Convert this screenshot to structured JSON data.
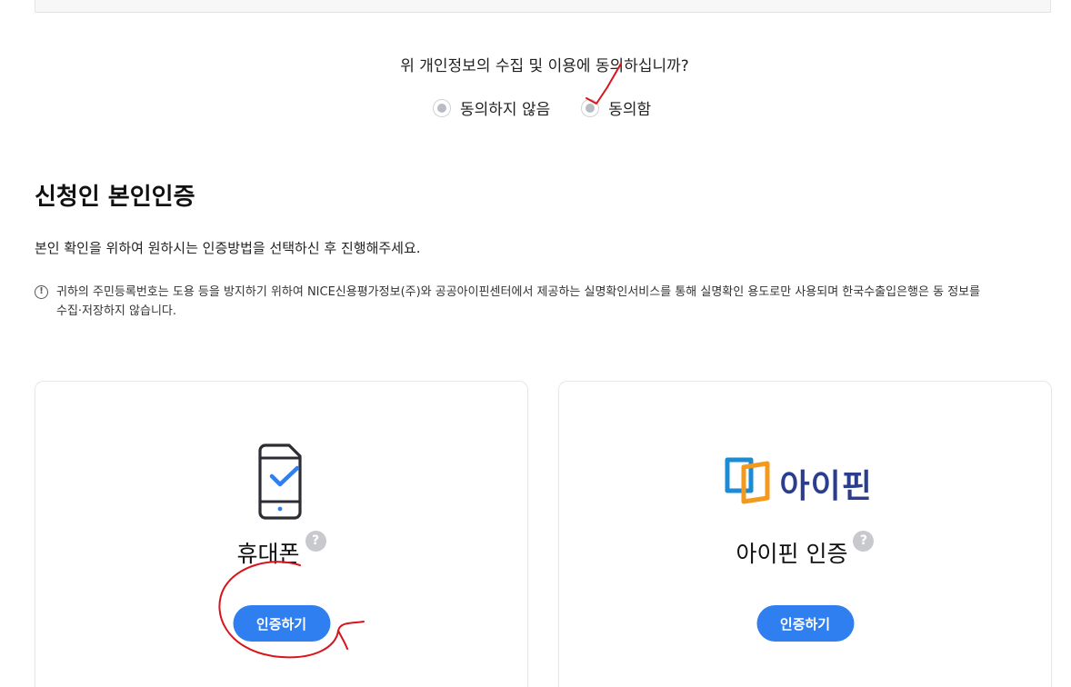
{
  "consent": {
    "question": "위 개인정보의 수집 및 이용에 동의하십니까?",
    "options": [
      {
        "label": "동의하지 않음"
      },
      {
        "label": "동의함"
      }
    ]
  },
  "verification": {
    "title": "신청인 본인인증",
    "description": "본인 확인을 위하여 원하시는 인증방법을 선택하신 후 진행해주세요.",
    "notice_line1": "귀하의 주민등록번호는 도용 등을 방지하기 위하여 NICE신용평가정보(주)와 공공아이핀센터에서 제공하는 실명확인서비스를 통해 실명확인 용도로만 사용되며 한국수출입은행은 동 정보를",
    "notice_line2": "수집·저장하지 않습니다.",
    "notice_icon": "!",
    "methods": [
      {
        "label": "휴대폰",
        "help": "?",
        "button": "인증하기",
        "icon": "mobile-phone-check-icon"
      },
      {
        "label": "아이핀 인증",
        "help": "?",
        "button": "인증하기",
        "icon": "ipin-logo",
        "logo_text": "아이핀"
      }
    ]
  },
  "colors": {
    "accent": "#2f7ff0",
    "annotation": "#d9141c",
    "ipin_blue": "#1b8bd6",
    "ipin_orange": "#f39a1e",
    "ipin_text": "#2a3d8f"
  }
}
